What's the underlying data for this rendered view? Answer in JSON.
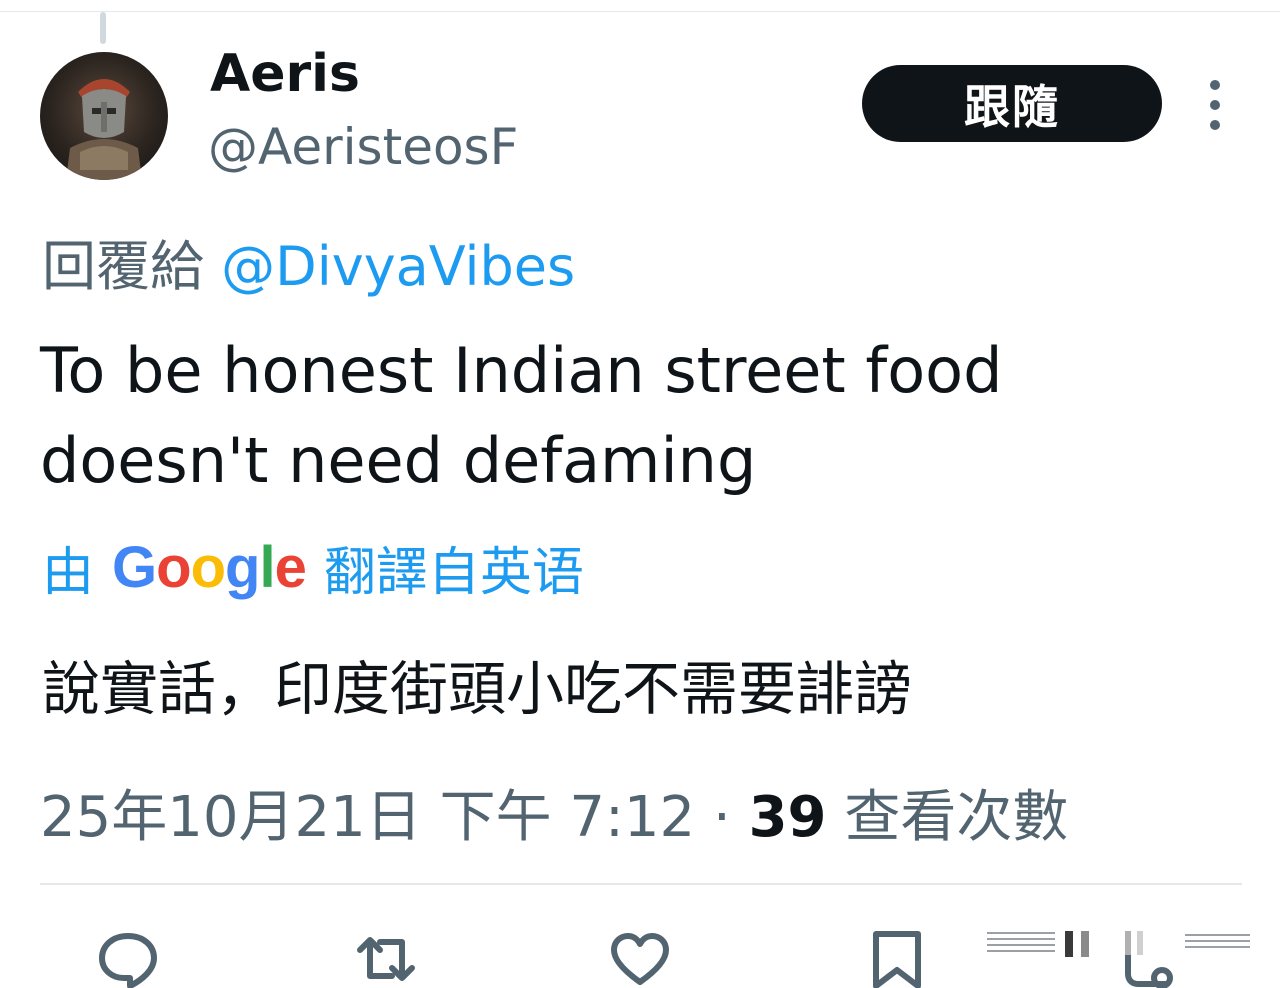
{
  "author": {
    "display_name": "Aeris",
    "handle": "@AeristeosF",
    "avatar": "armored-helmet-avatar"
  },
  "follow_label": "跟隨",
  "more_icon": "more-vertical-icon",
  "reply": {
    "prefix": "回覆給",
    "mention": "@DivyaVibes"
  },
  "tweet_text": "To be honest Indian street food doesn't need defaming",
  "translation": {
    "prefix": "由",
    "engine": "Google",
    "suffix": "翻譯自英语",
    "text": "說實話，印度街頭小吃不需要誹謗"
  },
  "meta": {
    "timestamp": "25年10月21日 下午 7:12",
    "separator": "·",
    "views_count": "39",
    "views_label": "查看次數"
  },
  "actions": [
    {
      "name": "reply",
      "icon": "reply-icon"
    },
    {
      "name": "retweet",
      "icon": "retweet-icon"
    },
    {
      "name": "like",
      "icon": "heart-icon"
    },
    {
      "name": "bookmark",
      "icon": "bookmark-icon"
    },
    {
      "name": "share",
      "icon": "share-icon"
    }
  ],
  "colors": {
    "text_primary": "#0f1419",
    "text_secondary": "#536471",
    "link": "#1d9bf0",
    "follow_bg": "#0f1419",
    "divider": "#e6e9ec"
  }
}
